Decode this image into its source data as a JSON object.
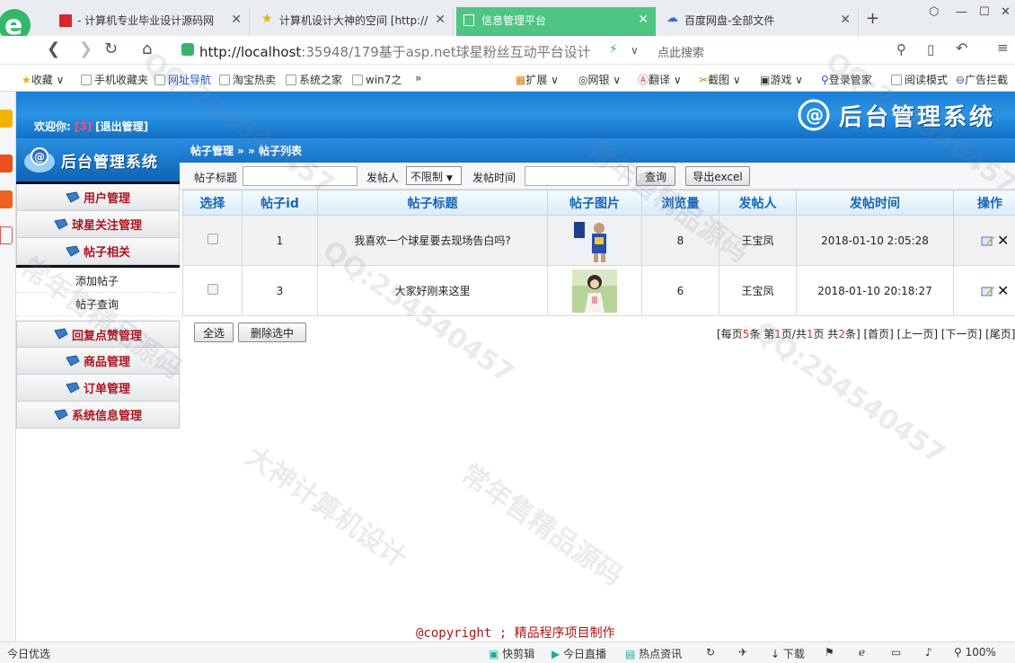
{
  "browser": {
    "tabs": [
      {
        "label": "- 计算机专业毕业设计源码网",
        "active": false
      },
      {
        "label": "计算机设计大神的空间 [http://",
        "active": false
      },
      {
        "label": "信息管理平台",
        "active": true
      },
      {
        "label": "百度网盘-全部文件",
        "active": false
      }
    ],
    "url_host": "http://localhost",
    "url_rest": ":35948/179基于asp.net球星粉丝互动平台设计",
    "search_placeholder": "点此搜索",
    "bookmarks": [
      "收藏",
      "手机收藏夹",
      "网址导航",
      "淘宝热卖",
      "系统之家",
      "win7之",
      "»",
      "扩展",
      "网银",
      "翻译",
      "截图",
      "游戏",
      "登录管家",
      "阅读模式",
      "广告拦截"
    ]
  },
  "header": {
    "welcome_label": "欢迎你:",
    "username": "[3]",
    "logout_label": "[退出管理]",
    "brand_title": "后台管理系统"
  },
  "menu": {
    "title": "后台管理系统",
    "items": [
      {
        "label": "用户管理"
      },
      {
        "label": "球星关注管理"
      },
      {
        "label": "帖子相关"
      },
      {
        "label": "回复点赞管理"
      },
      {
        "label": "商品管理"
      },
      {
        "label": "订单管理"
      },
      {
        "label": "系统信息管理"
      }
    ],
    "subitems": [
      "添加帖子",
      "帖子查询"
    ]
  },
  "content": {
    "breadcrumb": "帖子管理 » » 帖子列表",
    "filter": {
      "title_label": "帖子标题",
      "poster_label": "发帖人",
      "poster_value": "不限制",
      "time_label": "发帖时间",
      "search_button": "查询",
      "export_button": "导出excel"
    },
    "table": {
      "headers": [
        "选择",
        "帖子id",
        "帖子标题",
        "帖子图片",
        "浏览量",
        "发帖人",
        "发帖时间",
        "操作"
      ],
      "rows": [
        {
          "id": "1",
          "title": "我喜欢一个球星要去现场告白吗?",
          "views": "8",
          "poster": "王宝凤",
          "time": "2018-01-10 2:05:28"
        },
        {
          "id": "3",
          "title": "大家好刚来这里",
          "views": "6",
          "poster": "王宝凤",
          "time": "2018-01-10 20:18:27"
        }
      ]
    },
    "select_all_button": "全选",
    "delete_button": "删除选中",
    "pager": {
      "prefix": "[每页",
      "per_page": "5",
      "mid1": "条 第",
      "current": "1",
      "mid2": "页/共",
      "total_pages": "1",
      "mid3": "页 共",
      "total": "2",
      "suffix": "条]",
      "first": "[首页]",
      "prev": "[上一页]",
      "next": "[下一页]",
      "last": "[尾页]"
    },
    "copyright": "@copyright ; 精品程序项目制作"
  },
  "statusbar": {
    "left": "今日优选",
    "items": [
      "快剪辑",
      "今日直播",
      "热点资讯",
      "下载",
      "100%"
    ]
  },
  "watermark": [
    "QQ:254540457",
    "常年售精品源码",
    "大神计算机设计"
  ]
}
